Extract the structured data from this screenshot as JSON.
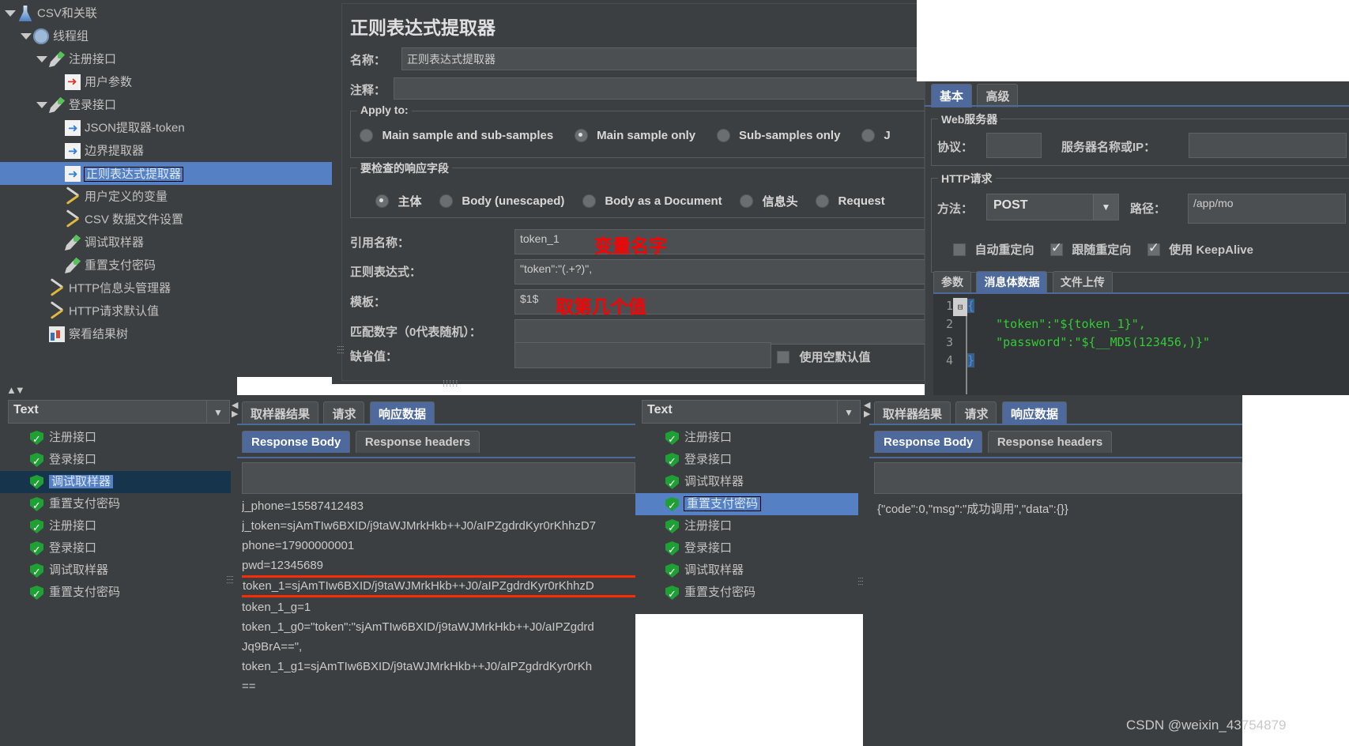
{
  "tree": {
    "items": [
      {
        "label": "CSV和关联",
        "icon": "flask-icon",
        "depth": 0,
        "twisty": true,
        "selected": false
      },
      {
        "label": "线程组",
        "icon": "gear-icon",
        "depth": 1,
        "twisty": true,
        "selected": false
      },
      {
        "label": "注册接口",
        "icon": "pipette-icon",
        "depth": 2,
        "twisty": true,
        "selected": false
      },
      {
        "label": "用户参数",
        "icon": "red-arrow-sheet-icon",
        "depth": 3,
        "twisty": false,
        "selected": false
      },
      {
        "label": "登录接口",
        "icon": "pipette-icon",
        "depth": 2,
        "twisty": true,
        "selected": false
      },
      {
        "label": "JSON提取器-token",
        "icon": "blue-arrow-sheet-icon",
        "depth": 3,
        "twisty": false,
        "selected": false
      },
      {
        "label": "边界提取器",
        "icon": "blue-arrow-sheet-icon",
        "depth": 3,
        "twisty": false,
        "selected": false
      },
      {
        "label": "正则表达式提取器",
        "icon": "blue-arrow-sheet-icon",
        "depth": 3,
        "twisty": false,
        "selected": true
      },
      {
        "label": "用户定义的变量",
        "icon": "tools-icon",
        "depth": 3,
        "twisty": false,
        "selected": false
      },
      {
        "label": "CSV 数据文件设置",
        "icon": "tools-icon",
        "depth": 3,
        "twisty": false,
        "selected": false
      },
      {
        "label": "调试取样器",
        "icon": "pipette-icon",
        "depth": 3,
        "twisty": false,
        "selected": false
      },
      {
        "label": "重置支付密码",
        "icon": "pipette-icon",
        "depth": 3,
        "twisty": false,
        "selected": false
      },
      {
        "label": "HTTP信息头管理器",
        "icon": "tools-icon",
        "depth": 2,
        "twisty": false,
        "selected": false
      },
      {
        "label": "HTTP请求默认值",
        "icon": "tools-icon",
        "depth": 2,
        "twisty": false,
        "selected": false
      },
      {
        "label": "察看结果树",
        "icon": "chart-icon",
        "depth": 2,
        "twisty": false,
        "selected": false
      }
    ]
  },
  "regex_extractor": {
    "title": "正则表达式提取器",
    "name_label": "名称：",
    "name_value": "正则表达式提取器",
    "comment_label": "注释：",
    "comment_value": "",
    "apply_to": {
      "group_title": "Apply to:",
      "options": [
        {
          "label": "Main sample and sub-samples",
          "selected": false
        },
        {
          "label": "Main sample only",
          "selected": true
        },
        {
          "label": "Sub-samples only",
          "selected": false
        },
        {
          "label": "J",
          "selected": false
        }
      ]
    },
    "field_to_check": {
      "group_title": "要检查的响应字段",
      "options": [
        {
          "label": "主体",
          "selected": true
        },
        {
          "label": "Body (unescaped)",
          "selected": false
        },
        {
          "label": "Body as a Document",
          "selected": false
        },
        {
          "label": "信息头",
          "selected": false
        },
        {
          "label": "Request",
          "selected": false
        }
      ]
    },
    "rows": [
      {
        "label": "引用名称：",
        "value": "token_1"
      },
      {
        "label": "正则表达式：",
        "value": "\"token\":\"(.+?)\","
      },
      {
        "label": "模板：",
        "value": "$1$"
      },
      {
        "label": "匹配数字（0代表随机）：",
        "value": ""
      },
      {
        "label": "缺省值：",
        "value": ""
      }
    ],
    "empty_default_checkbox": {
      "label": "使用空默认值",
      "checked": false
    }
  },
  "annotations": [
    {
      "text": "变量名字"
    },
    {
      "text": "取第几个值"
    }
  ],
  "http_request": {
    "tabs": [
      {
        "label": "基本",
        "selected": true
      },
      {
        "label": "高级",
        "selected": false
      }
    ],
    "web_server": {
      "group_title": "Web服务器",
      "protocol_label": "协议：",
      "protocol_value": "",
      "server_label": "服务器名称或IP：",
      "server_value": ""
    },
    "http_section": {
      "group_title": "HTTP请求",
      "method_label": "方法：",
      "method_value": "POST",
      "path_label": "路径：",
      "path_value": "/app/mo",
      "checkboxes": [
        {
          "label": "自动重定向",
          "checked": false
        },
        {
          "label": "跟随重定向",
          "checked": true
        },
        {
          "label": "使用 KeepAlive",
          "checked": true
        }
      ],
      "body_tabs": [
        {
          "label": "参数",
          "selected": false
        },
        {
          "label": "消息体数据",
          "selected": true
        },
        {
          "label": "文件上传",
          "selected": false
        }
      ],
      "body_lines": [
        {
          "num": "1",
          "text": "{",
          "fold": true
        },
        {
          "num": "2",
          "text": "    \"token\":\"${token_1}\",",
          "fold": false
        },
        {
          "num": "3",
          "text": "    \"password\":\"${__MD5(123456,)}\"",
          "fold": false
        },
        {
          "num": "4",
          "text": "}",
          "fold": false
        }
      ]
    }
  },
  "result_panel_left": {
    "search_value": "Text",
    "tree_items": [
      {
        "label": "注册接口",
        "selected": false
      },
      {
        "label": "登录接口",
        "selected": false
      },
      {
        "label": "调试取样器",
        "selected": true
      },
      {
        "label": "重置支付密码",
        "selected": false
      },
      {
        "label": "注册接口",
        "selected": false
      },
      {
        "label": "登录接口",
        "selected": false
      },
      {
        "label": "调试取样器",
        "selected": false
      },
      {
        "label": "重置支付密码",
        "selected": false
      }
    ],
    "tabs": [
      {
        "label": "取样器结果",
        "selected": false
      },
      {
        "label": "请求",
        "selected": false
      },
      {
        "label": "响应数据",
        "selected": true
      }
    ],
    "subtabs": [
      {
        "label": "Response Body",
        "selected": true
      },
      {
        "label": "Response headers",
        "selected": false
      }
    ],
    "search_box_value": "",
    "body_lines": [
      {
        "text": "j_phone=15587412483",
        "highlight": false
      },
      {
        "text": "j_token=sjAmTIw6BXID/j9taWJMrkHkb++J0/aIPZgdrdKyr0rKhhzD7",
        "highlight": false
      },
      {
        "text": "phone=17900000001",
        "highlight": false
      },
      {
        "text": "pwd=12345689",
        "highlight": false
      },
      {
        "text": "token_1=sjAmTIw6BXID/j9taWJMrkHkb++J0/aIPZgdrdKyr0rKhhzD",
        "highlight": true
      },
      {
        "text": "token_1_g=1",
        "highlight": false
      },
      {
        "text": "token_1_g0=\"token\":\"sjAmTIw6BXID/j9taWJMrkHkb++J0/aIPZgdrd",
        "highlight": false
      },
      {
        "text": "Jq9BrA==\",",
        "highlight": false
      },
      {
        "text": "token_1_g1=sjAmTIw6BXID/j9taWJMrkHkb++J0/aIPZgdrdKyr0rKh",
        "highlight": false
      },
      {
        "text": "==",
        "highlight": false
      }
    ]
  },
  "result_panel_right": {
    "search_value": "Text",
    "tree_items": [
      {
        "label": "注册接口",
        "selected": false
      },
      {
        "label": "登录接口",
        "selected": false
      },
      {
        "label": "调试取样器",
        "selected": false
      },
      {
        "label": "重置支付密码",
        "selected": true
      },
      {
        "label": "注册接口",
        "selected": false
      },
      {
        "label": "登录接口",
        "selected": false
      },
      {
        "label": "调试取样器",
        "selected": false
      },
      {
        "label": "重置支付密码",
        "selected": false
      }
    ],
    "tabs": [
      {
        "label": "取样器结果",
        "selected": false
      },
      {
        "label": "请求",
        "selected": false
      },
      {
        "label": "响应数据",
        "selected": true
      }
    ],
    "subtabs": [
      {
        "label": "Response Body",
        "selected": true
      },
      {
        "label": "Response headers",
        "selected": false
      }
    ],
    "search_box_value": "",
    "body_text": "{\"code\":0,\"msg\":\"成功调用\",\"data\":{}}"
  },
  "watermark": "CSDN @weixin_43754879",
  "colors": {
    "panel_bg": "#3c3f41",
    "field_bg": "#4b4f51",
    "selection_blue": "#5580c3",
    "tab_blue": "#4e6a9c",
    "annotation_red": "#ff0000",
    "code_green": "#33cc33"
  }
}
